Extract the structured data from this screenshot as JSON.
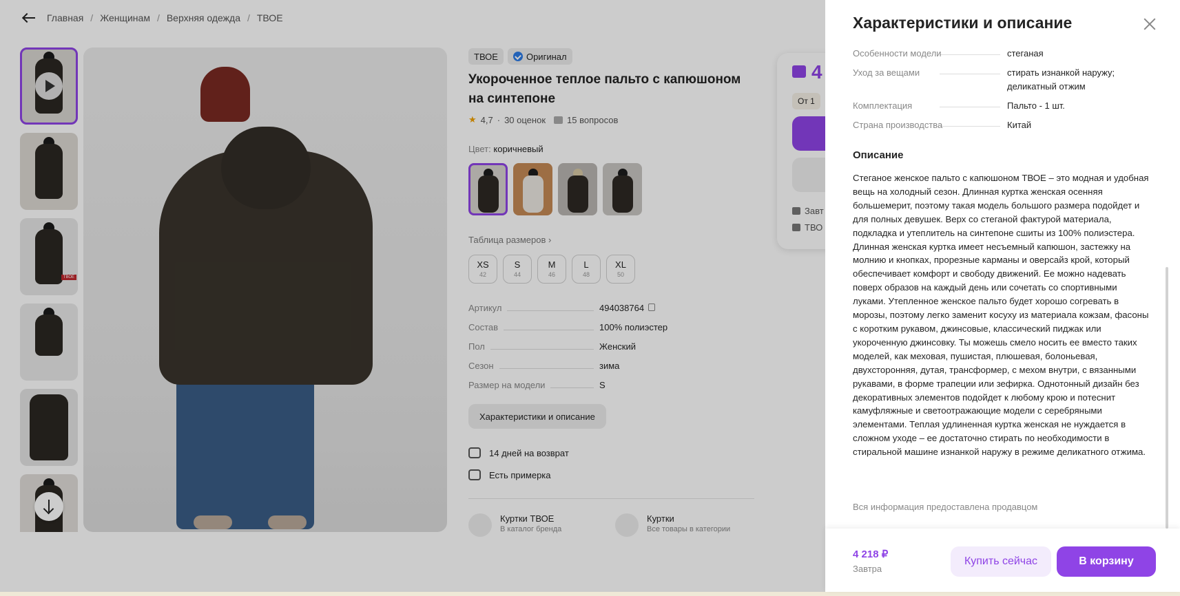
{
  "breadcrumbs": [
    "Главная",
    "Женщинам",
    "Верхняя одежда",
    "ТВОЕ"
  ],
  "product": {
    "brand": "ТВОЕ",
    "badge": "Оригинал",
    "title": "Укороченное теплое пальто с капюшоном на синтепоне",
    "rating": "4,7",
    "reviews": "30 оценок",
    "questions": "15 вопросов",
    "color_label": "Цвет:",
    "color_value": "коричневый",
    "size_table_link": "Таблица размеров",
    "sizes": [
      {
        "label": "XS",
        "ru": "42"
      },
      {
        "label": "S",
        "ru": "44"
      },
      {
        "label": "M",
        "ru": "46"
      },
      {
        "label": "L",
        "ru": "48"
      },
      {
        "label": "XL",
        "ru": "50"
      }
    ],
    "attributes": [
      {
        "key": "Артикул",
        "value": "494038764"
      },
      {
        "key": "Состав",
        "value": "100% полиэстер"
      },
      {
        "key": "Пол",
        "value": "Женский"
      },
      {
        "key": "Сезон",
        "value": "зима"
      },
      {
        "key": "Размер на модели",
        "value": "S"
      }
    ],
    "char_button": "Характеристики и описание",
    "services": [
      "14 дней на возврат",
      "Есть примерка"
    ],
    "categories": [
      {
        "title": "Куртки ТВОЕ",
        "sub": "В каталог бренда"
      },
      {
        "title": "Куртки",
        "sub": "Все товары в категории"
      }
    ],
    "thumb_tag": "ТВОЕ"
  },
  "buy_card": {
    "price_fragment": "4",
    "from_fragment": "От 1",
    "delivery_fragment": "Завт",
    "seller_fragment": "ТВО"
  },
  "panel": {
    "title": "Характеристики и описание",
    "specs": [
      {
        "key": "Особенности модели",
        "value": "стеганая"
      },
      {
        "key": "Уход за вещами",
        "value": "стирать изнанкой наружу; деликатный отжим"
      },
      {
        "key": "Комплектация",
        "value": "Пальто - 1 шт."
      },
      {
        "key": "Страна производства",
        "value": "Китай"
      }
    ],
    "description_title": "Описание",
    "description": "Стеганое женское пальто с капюшоном ТВОЕ – это модная и удобная вещь на холодный сезон. Длинная куртка женская осенняя большемерит, поэтому такая модель большого размера подойдет и для полных девушек. Верх со стеганой фактурой материала, подкладка и утеплитель на синтепоне сшиты из 100% полиэстера. Длинная женская куртка имеет несъемный капюшон, застежку на молнию и кнопках, прорезные карманы и оверсайз крой, который обеспечивает комфорт и свободу движений. Ее можно надевать поверх образов на каждый день или сочетать со спортивными луками. Утепленное женское пальто будет хорошо согревать в морозы, поэтому легко заменит косуху из материала кожзам, фасоны с коротким рукавом, джинсовые, классический пиджак или укороченную джинсовку. Ты можешь смело носить ее вместо таких моделей, как меховая, пушистая, плюшевая, болоньевая, двухсторонняя, дутая, трансформер, с мехом внутри, с вязанными рукавами, в форме трапеции или зефирка. Однотонный дизайн без декоративных элементов подойдет к любому крою и потеснит камуфляжные и светоотражающие модели с серебряными элементами. Теплая удлиненная куртка женская не нуждается в сложном уходе – ее достаточно стирать по необходимости в стиральной машине изнанкой наружу в режиме деликатного отжима.",
    "seller_note": "Вся информация предоставлена продавцом",
    "footer": {
      "price": "4 218 ₽",
      "when": "Завтра",
      "buy_now": "Купить сейчас",
      "add_to_cart": "В корзину"
    }
  },
  "colors": {
    "accent": "#8f44e6",
    "overlay": "rgba(0,0,0,0.20)"
  }
}
